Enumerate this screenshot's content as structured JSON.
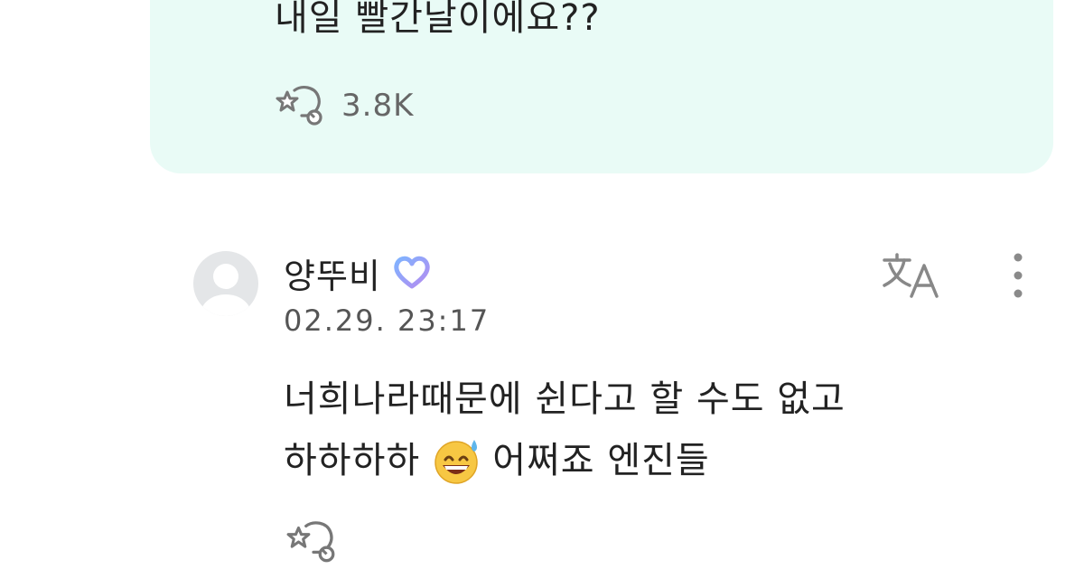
{
  "post": {
    "text": "내일 빨간날이에요??",
    "reaction_count": "3.8K"
  },
  "comment": {
    "author": "양뚜비",
    "badge_icon": "artist-heart-badge-icon",
    "timestamp": "02.29. 23:17",
    "line1": "너희나라때문에 쉰다고 할 수도 없고",
    "line2_before": "하하하하",
    "emoji": "grinning-sweat-emoji",
    "line2_after": "어쩌죠 엔진들"
  },
  "icons": {
    "reaction": "reaction-icon",
    "translate": "translate-icon",
    "more": "more-vertical-icon"
  },
  "colors": {
    "bubble": "#e9fbf6",
    "badge_gradient": [
      "#7fb3ff",
      "#b48cf0"
    ]
  }
}
